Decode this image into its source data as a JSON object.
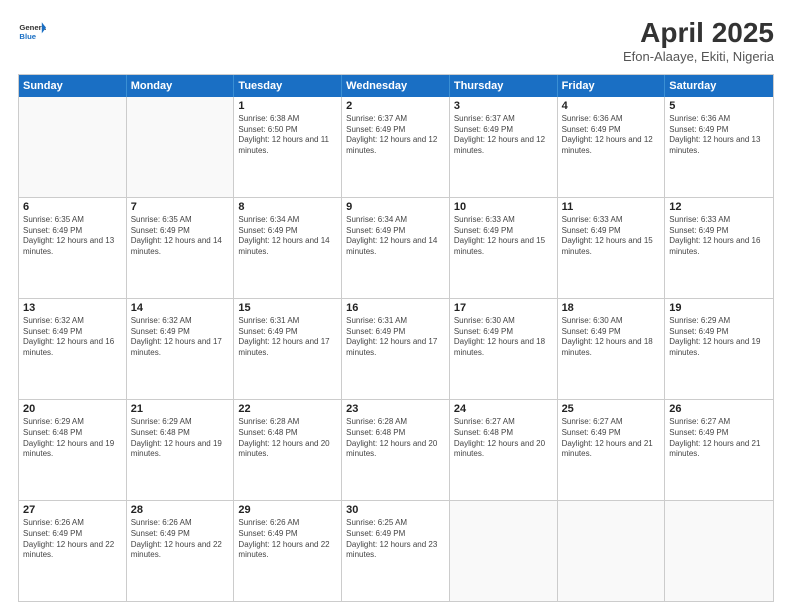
{
  "logo": {
    "line1": "General",
    "line2": "Blue"
  },
  "title": "April 2025",
  "subtitle": "Efon-Alaaye, Ekiti, Nigeria",
  "weekdays": [
    "Sunday",
    "Monday",
    "Tuesday",
    "Wednesday",
    "Thursday",
    "Friday",
    "Saturday"
  ],
  "weeks": [
    [
      {
        "day": "",
        "info": ""
      },
      {
        "day": "",
        "info": ""
      },
      {
        "day": "1",
        "info": "Sunrise: 6:38 AM\nSunset: 6:50 PM\nDaylight: 12 hours and 11 minutes."
      },
      {
        "day": "2",
        "info": "Sunrise: 6:37 AM\nSunset: 6:49 PM\nDaylight: 12 hours and 12 minutes."
      },
      {
        "day": "3",
        "info": "Sunrise: 6:37 AM\nSunset: 6:49 PM\nDaylight: 12 hours and 12 minutes."
      },
      {
        "day": "4",
        "info": "Sunrise: 6:36 AM\nSunset: 6:49 PM\nDaylight: 12 hours and 12 minutes."
      },
      {
        "day": "5",
        "info": "Sunrise: 6:36 AM\nSunset: 6:49 PM\nDaylight: 12 hours and 13 minutes."
      }
    ],
    [
      {
        "day": "6",
        "info": "Sunrise: 6:35 AM\nSunset: 6:49 PM\nDaylight: 12 hours and 13 minutes."
      },
      {
        "day": "7",
        "info": "Sunrise: 6:35 AM\nSunset: 6:49 PM\nDaylight: 12 hours and 14 minutes."
      },
      {
        "day": "8",
        "info": "Sunrise: 6:34 AM\nSunset: 6:49 PM\nDaylight: 12 hours and 14 minutes."
      },
      {
        "day": "9",
        "info": "Sunrise: 6:34 AM\nSunset: 6:49 PM\nDaylight: 12 hours and 14 minutes."
      },
      {
        "day": "10",
        "info": "Sunrise: 6:33 AM\nSunset: 6:49 PM\nDaylight: 12 hours and 15 minutes."
      },
      {
        "day": "11",
        "info": "Sunrise: 6:33 AM\nSunset: 6:49 PM\nDaylight: 12 hours and 15 minutes."
      },
      {
        "day": "12",
        "info": "Sunrise: 6:33 AM\nSunset: 6:49 PM\nDaylight: 12 hours and 16 minutes."
      }
    ],
    [
      {
        "day": "13",
        "info": "Sunrise: 6:32 AM\nSunset: 6:49 PM\nDaylight: 12 hours and 16 minutes."
      },
      {
        "day": "14",
        "info": "Sunrise: 6:32 AM\nSunset: 6:49 PM\nDaylight: 12 hours and 17 minutes."
      },
      {
        "day": "15",
        "info": "Sunrise: 6:31 AM\nSunset: 6:49 PM\nDaylight: 12 hours and 17 minutes."
      },
      {
        "day": "16",
        "info": "Sunrise: 6:31 AM\nSunset: 6:49 PM\nDaylight: 12 hours and 17 minutes."
      },
      {
        "day": "17",
        "info": "Sunrise: 6:30 AM\nSunset: 6:49 PM\nDaylight: 12 hours and 18 minutes."
      },
      {
        "day": "18",
        "info": "Sunrise: 6:30 AM\nSunset: 6:49 PM\nDaylight: 12 hours and 18 minutes."
      },
      {
        "day": "19",
        "info": "Sunrise: 6:29 AM\nSunset: 6:49 PM\nDaylight: 12 hours and 19 minutes."
      }
    ],
    [
      {
        "day": "20",
        "info": "Sunrise: 6:29 AM\nSunset: 6:48 PM\nDaylight: 12 hours and 19 minutes."
      },
      {
        "day": "21",
        "info": "Sunrise: 6:29 AM\nSunset: 6:48 PM\nDaylight: 12 hours and 19 minutes."
      },
      {
        "day": "22",
        "info": "Sunrise: 6:28 AM\nSunset: 6:48 PM\nDaylight: 12 hours and 20 minutes."
      },
      {
        "day": "23",
        "info": "Sunrise: 6:28 AM\nSunset: 6:48 PM\nDaylight: 12 hours and 20 minutes."
      },
      {
        "day": "24",
        "info": "Sunrise: 6:27 AM\nSunset: 6:48 PM\nDaylight: 12 hours and 20 minutes."
      },
      {
        "day": "25",
        "info": "Sunrise: 6:27 AM\nSunset: 6:49 PM\nDaylight: 12 hours and 21 minutes."
      },
      {
        "day": "26",
        "info": "Sunrise: 6:27 AM\nSunset: 6:49 PM\nDaylight: 12 hours and 21 minutes."
      }
    ],
    [
      {
        "day": "27",
        "info": "Sunrise: 6:26 AM\nSunset: 6:49 PM\nDaylight: 12 hours and 22 minutes."
      },
      {
        "day": "28",
        "info": "Sunrise: 6:26 AM\nSunset: 6:49 PM\nDaylight: 12 hours and 22 minutes."
      },
      {
        "day": "29",
        "info": "Sunrise: 6:26 AM\nSunset: 6:49 PM\nDaylight: 12 hours and 22 minutes."
      },
      {
        "day": "30",
        "info": "Sunrise: 6:25 AM\nSunset: 6:49 PM\nDaylight: 12 hours and 23 minutes."
      },
      {
        "day": "",
        "info": ""
      },
      {
        "day": "",
        "info": ""
      },
      {
        "day": "",
        "info": ""
      }
    ]
  ]
}
